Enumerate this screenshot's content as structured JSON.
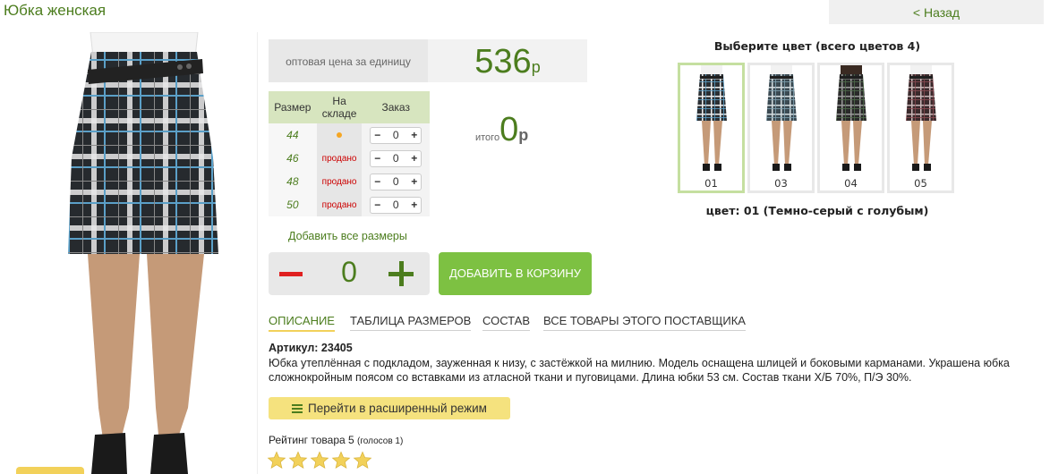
{
  "header": {
    "title": "Юбка женская",
    "back_label": "< Назад"
  },
  "price": {
    "label": "оптовая цена за единицу",
    "value": "536",
    "currency": "р"
  },
  "sizes_table": {
    "headers": [
      "Размер",
      "На складе",
      "Заказ"
    ],
    "rows": [
      {
        "size": "44",
        "stock": "",
        "qty": "0"
      },
      {
        "size": "46",
        "stock": "продано",
        "qty": "0"
      },
      {
        "size": "48",
        "stock": "продано",
        "qty": "0"
      },
      {
        "size": "50",
        "stock": "продано",
        "qty": "0"
      }
    ],
    "minus": "−",
    "plus": "+"
  },
  "total": {
    "label": "итого",
    "value": "0",
    "currency": "р"
  },
  "add_all_sizes_label": "Добавить все размеры",
  "quantity": {
    "value": "0"
  },
  "add_to_cart_label": "ДОБАВИТЬ В КОРЗИНУ",
  "colors": {
    "heading": "Выберите цвет (всего цветов 4)",
    "items": [
      {
        "code": "01",
        "selected": true,
        "palette": [
          "#2b2f33",
          "#eeeeee",
          "#5ba0c8"
        ]
      },
      {
        "code": "03",
        "selected": false,
        "palette": [
          "#3b4a52",
          "#d5dde0",
          "#7fa1b0"
        ]
      },
      {
        "code": "04",
        "selected": false,
        "palette": [
          "#2a2a2a",
          "#9b9b9b",
          "#4e6b4a"
        ]
      },
      {
        "code": "05",
        "selected": false,
        "palette": [
          "#3a2a2c",
          "#c9b7b7",
          "#8a4a52"
        ]
      }
    ],
    "caption": "цвет: 01 (Темно-серый с голубым)"
  },
  "tabs": [
    {
      "label": "ОПИСАНИЕ",
      "active": true
    },
    {
      "label": "ТАБЛИЦА РАЗМЕРОВ",
      "active": false
    },
    {
      "label": "СОСТАВ",
      "active": false
    },
    {
      "label": "ВСЕ ТОВАРЫ ЭТОГО ПОСТАВЩИКА",
      "active": false
    }
  ],
  "article": "Артикул: 23405",
  "description": "Юбка утеплённая с подкладом, зауженная к низу, с застёжкой на милнию. Модель оснащена шлицей и боковыми карманами. Украшена юбка сложнокройным поясом со вставками из атласной ткани и пуговицами. Длина юбки 53 см. Состав ткани Х/Б 70%, П/Э 30%.",
  "extended_mode_label": "Перейти в расширенный режим",
  "rating": {
    "text": "Рейтинг товара 5",
    "votes": "(голосов 1)",
    "stars": 5
  },
  "theme": {
    "accent_green": "#4c7d1e",
    "button_green": "#7dc142",
    "minus_red": "#e02020",
    "star_yellow": "#f2d15a"
  }
}
